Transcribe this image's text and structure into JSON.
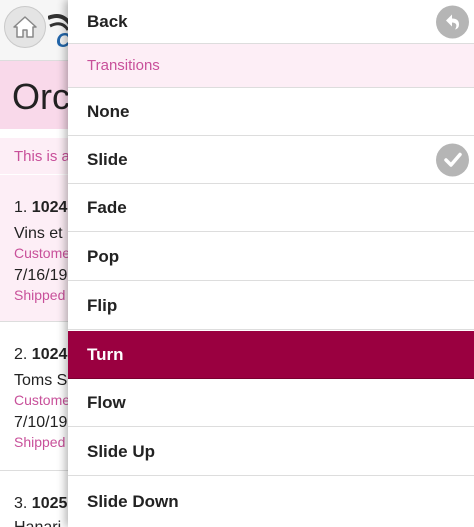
{
  "background": {
    "header": {
      "home_icon": "home-icon",
      "logo_letter": "C"
    },
    "page_title": "Orc",
    "subtitle": "This is a",
    "orders": [
      {
        "prefix": "1.",
        "number": "1024",
        "name": "Vins et",
        "customer": "Custome",
        "date": "7/16/19",
        "status": "Shipped"
      },
      {
        "prefix": "2.",
        "number": "1024",
        "name": "Toms S",
        "customer": "Custome",
        "date": "7/10/19",
        "status": "Shipped"
      },
      {
        "prefix": "3.",
        "number": "1025",
        "name": "Hanari"
      }
    ]
  },
  "menu": {
    "back": {
      "label": "Back",
      "icon": "back-arrow-icon"
    },
    "section_header": "Transitions",
    "items": [
      {
        "label": "None"
      },
      {
        "label": "Slide",
        "checked": true,
        "icon": "checkmark-icon"
      },
      {
        "label": "Fade"
      },
      {
        "label": "Pop"
      },
      {
        "label": "Flip"
      },
      {
        "label": "Turn",
        "active": true
      },
      {
        "label": "Flow"
      },
      {
        "label": "Slide Up"
      },
      {
        "label": "Slide Down"
      }
    ]
  },
  "colors": {
    "accent_pink": "#c8509a",
    "active_item": "#9a0040",
    "title_bar": "#f9d9ea",
    "row_highlight": "#fdeef6"
  }
}
